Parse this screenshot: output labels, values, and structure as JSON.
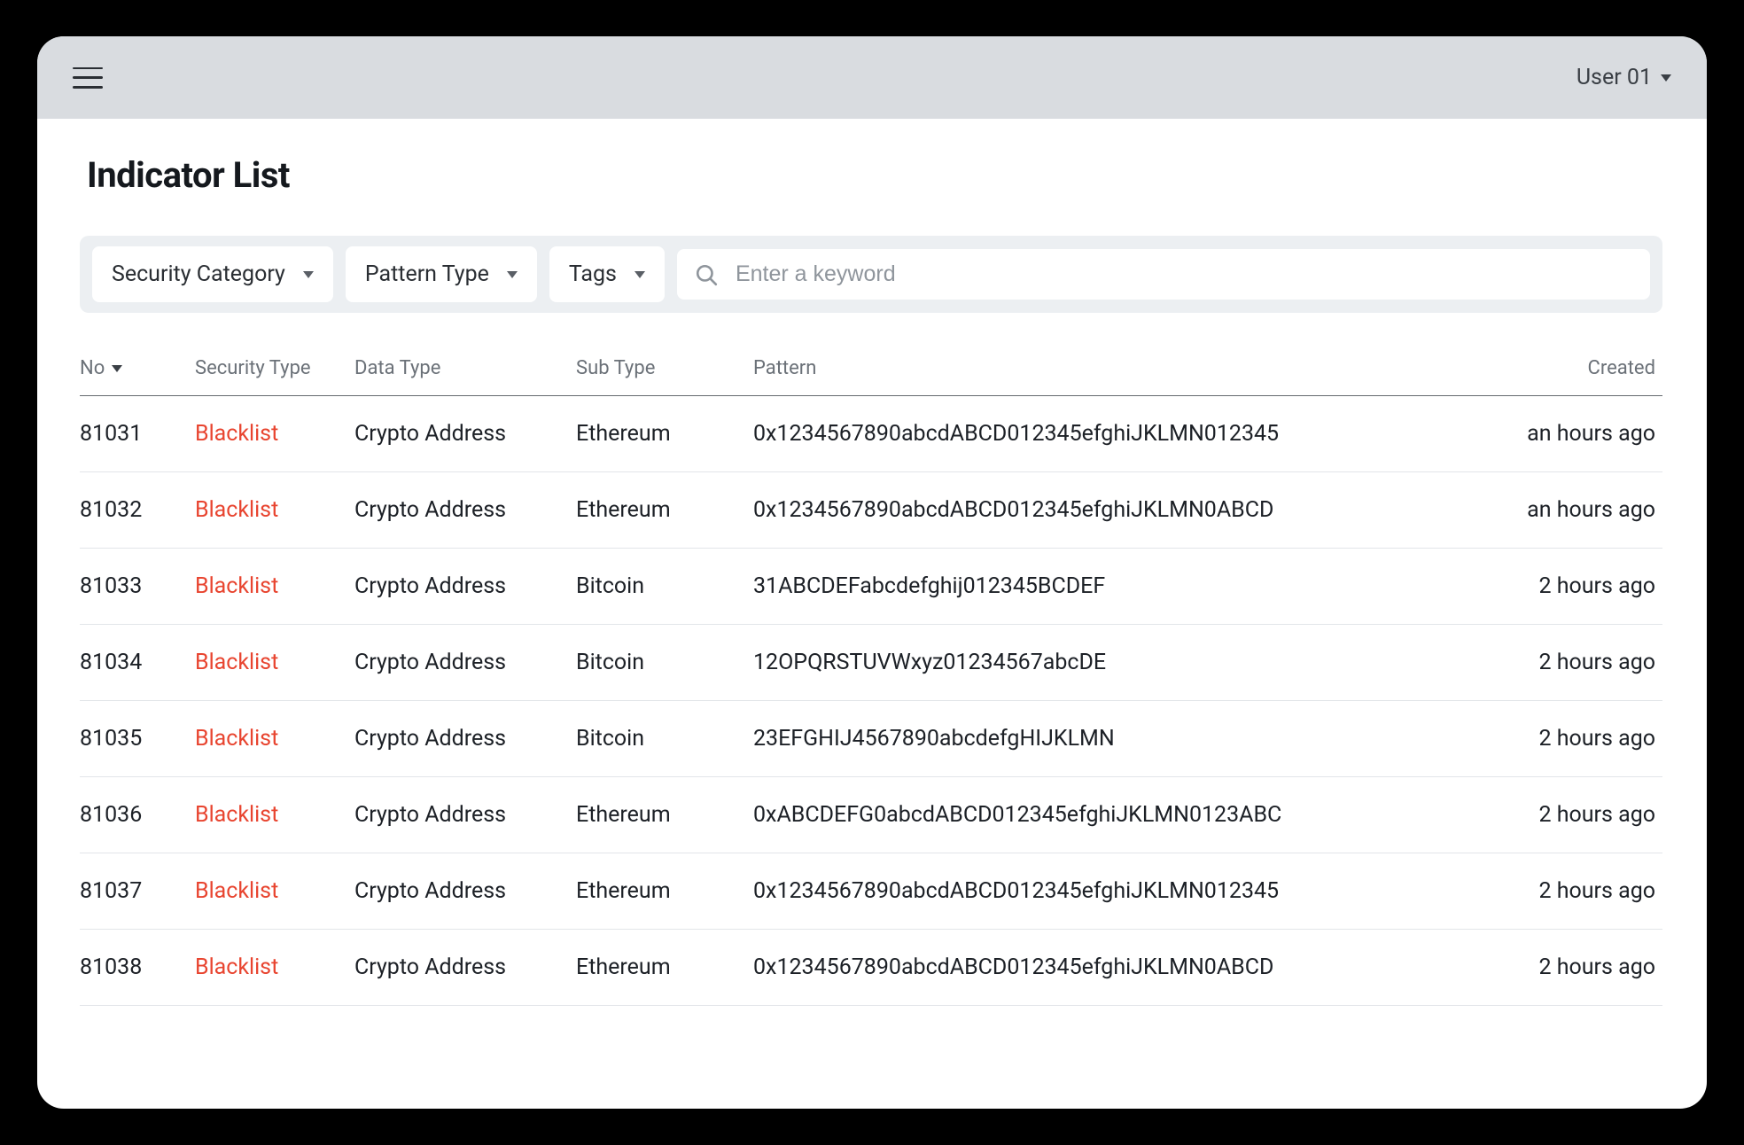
{
  "header": {
    "user_label": "User 01"
  },
  "page": {
    "title": "Indicator List"
  },
  "filters": {
    "security_category": "Security Category",
    "pattern_type": "Pattern Type",
    "tags": "Tags",
    "search_placeholder": "Enter a keyword"
  },
  "table": {
    "headers": {
      "no": "No",
      "security_type": "Security Type",
      "data_type": "Data Type",
      "sub_type": "Sub Type",
      "pattern": "Pattern",
      "created": "Created"
    },
    "rows": [
      {
        "no": "81031",
        "security_type": "Blacklist",
        "data_type": "Crypto Address",
        "sub_type": "Ethereum",
        "pattern": "0x1234567890abcdABCD012345efghiJKLMN012345",
        "created": "an hours ago"
      },
      {
        "no": "81032",
        "security_type": "Blacklist",
        "data_type": "Crypto Address",
        "sub_type": "Ethereum",
        "pattern": "0x1234567890abcdABCD012345efghiJKLMN0ABCD",
        "created": "an hours ago"
      },
      {
        "no": "81033",
        "security_type": "Blacklist",
        "data_type": "Crypto Address",
        "sub_type": "Bitcoin",
        "pattern": "31ABCDEFabcdefghij012345BCDEF",
        "created": "2 hours ago"
      },
      {
        "no": "81034",
        "security_type": "Blacklist",
        "data_type": "Crypto Address",
        "sub_type": "Bitcoin",
        "pattern": "12OPQRSTUVWxyz01234567abcDE",
        "created": "2 hours ago"
      },
      {
        "no": "81035",
        "security_type": "Blacklist",
        "data_type": "Crypto Address",
        "sub_type": "Bitcoin",
        "pattern": "23EFGHIJ4567890abcdefgHIJKLMN",
        "created": "2 hours ago"
      },
      {
        "no": "81036",
        "security_type": "Blacklist",
        "data_type": "Crypto Address",
        "sub_type": "Ethereum",
        "pattern": "0xABCDEFG0abcdABCD012345efghiJKLMN0123ABC",
        "created": "2 hours ago"
      },
      {
        "no": "81037",
        "security_type": "Blacklist",
        "data_type": "Crypto Address",
        "sub_type": "Ethereum",
        "pattern": "0x1234567890abcdABCD012345efghiJKLMN012345",
        "created": "2 hours ago"
      },
      {
        "no": "81038",
        "security_type": "Blacklist",
        "data_type": "Crypto Address",
        "sub_type": "Ethereum",
        "pattern": "0x1234567890abcdABCD012345efghiJKLMN0ABCD",
        "created": "2 hours ago"
      }
    ]
  }
}
